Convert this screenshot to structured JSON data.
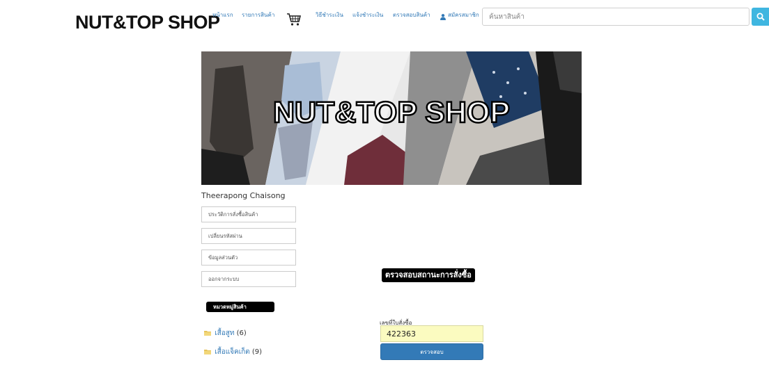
{
  "header": {
    "logo": "NUT&TOP SHOP",
    "nav": {
      "home": "หน้าแรก",
      "products": "รายการสินค้า",
      "payment_method": "วิธีชำระเงิน",
      "payment_notify": "แจ้งชำระเงิน",
      "check_product": "ตรวจสอบสินค้า",
      "register": "สมัครสมาชิก"
    },
    "search": {
      "placeholder": "ค้นหาสินค้า"
    }
  },
  "banner": {
    "title": "NUT&TOP SHOP"
  },
  "sidebar": {
    "username": "Theerapong Chaisong",
    "menu": {
      "order_history": "ประวัติการสั่งซื้อสินค้า",
      "change_password": "เปลี่ยนรหัสผ่าน",
      "profile": "ข้อมูลส่วนตัว",
      "logout": "ออกจากระบบ"
    },
    "category_header": "หมวดหมู่สินค้า",
    "categories": [
      {
        "name": "เสื้อสูท",
        "count": "(6)"
      },
      {
        "name": "เสื้อแจ็คเก็ต",
        "count": "(9)"
      }
    ]
  },
  "main": {
    "status_title": "ตรวจสอบสถานะการสั่งซื้อ",
    "order_label": "เลขที่ใบสั่งซื้อ",
    "order_value": "422363",
    "check_button": "ตรวจสอบ"
  },
  "colors": {
    "link": "#337ab7",
    "search_button": "#3fb6e0",
    "primary_button": "#337ab7",
    "order_input_bg": "#fbfbc0"
  }
}
